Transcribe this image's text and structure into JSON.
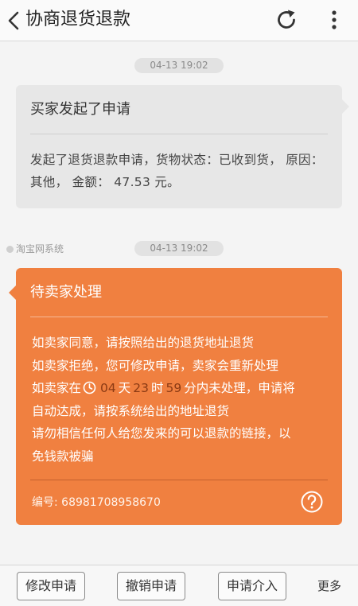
{
  "header": {
    "title": "协商退货退款",
    "icons": {
      "back": "chevron-left-icon",
      "refresh": "refresh-icon",
      "more": "more-vertical-icon"
    }
  },
  "messages": [
    {
      "timestamp": "04-13 19:02",
      "title": "买家发起了申请",
      "body": "发起了退货退款申请，货物状态：已收到货， 原因：其他， 金额： 47.53 元。"
    },
    {
      "timestamp": "04-13 19:02",
      "sender": "淘宝网系统",
      "title": "待卖家处理",
      "line1": "如卖家同意，请按照给出的退货地址退货",
      "line2": "如卖家拒绝，您可修改申请，卖家会重新处理",
      "line3_prefix": "如卖家在",
      "countdown": {
        "days": "04",
        "days_label": "天",
        "hours": "23",
        "hours_label": "时",
        "minutes": "59",
        "minutes_label": "分"
      },
      "line3_suffix": "内未处理，申请将",
      "line4": "自动达成，请按系统给出的地址退货",
      "line5": "请勿相信任何人给您发来的可以退款的链接，以",
      "line6": "免钱款被骗",
      "order_label": "编号:",
      "order_number": "68981708958670"
    }
  ],
  "bottom_bar": {
    "modify": "修改申请",
    "cancel": "撤销申请",
    "intervene": "申请介入",
    "more": "更多"
  },
  "colors": {
    "orange_bubble": "#f08040",
    "gray_bubble": "#e7e7e7",
    "countdown_number": "#8b3a14"
  }
}
